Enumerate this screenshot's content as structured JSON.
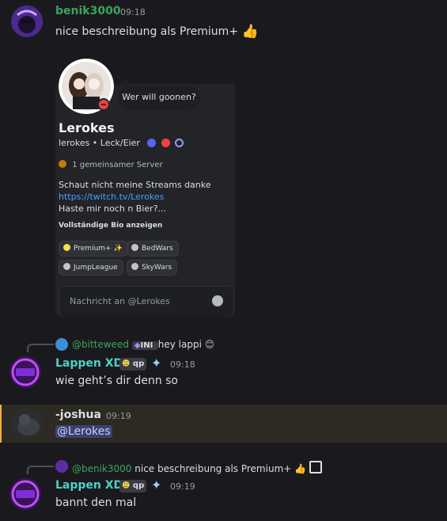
{
  "message1": {
    "username": "benik3000",
    "username_color": "#3ba55c",
    "time": "09:18",
    "text": "nice beschreibung als Premium+",
    "emoji": "👍"
  },
  "profile_card": {
    "status_bubble": "Wer will goonen?",
    "display_name": "Lerokes",
    "subline": "lerokes • Leck/Eier",
    "mutual_servers": "1 gemeinsamer Server",
    "bio_line1": "Schaut nicht meine Streams danke",
    "bio_link": "https://twitch.tv/Lerokes",
    "bio_line3": "Haste mir noch n Bier?...",
    "show_full_bio": "Vollständige Bio anzeigen",
    "roles": [
      {
        "label": "Premium+ ✨",
        "color": "#fde047"
      },
      {
        "label": "BedWars",
        "color": "#c4c4c4"
      },
      {
        "label": "JumpLeague",
        "color": "#c4c4c4"
      },
      {
        "label": "SkyWars",
        "color": "#c4c4c4"
      }
    ],
    "message_placeholder": "Nachricht an @Lerokes"
  },
  "message2": {
    "reply_user": "@bitteweed",
    "reply_user_color": "#3ba55c",
    "reply_tag": "INI",
    "reply_text": "hey lappi",
    "reply_emoji": "😊",
    "username": "Lappen XD",
    "username_color": "#4fd1c5",
    "badge": "qp",
    "time": "09:18",
    "text": "wie geht’s dir denn so"
  },
  "message3": {
    "username": "-joshua",
    "username_color": "#dbdee1",
    "time": "09:19",
    "mention": "@Lerokes"
  },
  "message4": {
    "reply_user": "@benik3000",
    "reply_user_color": "#3ba55c",
    "reply_text": "nice beschreibung als Premium+",
    "reply_emoji": "👍",
    "username": "Lappen XD",
    "username_color": "#4fd1c5",
    "badge": "qp",
    "time": "09:19",
    "text": "bannt den mal"
  }
}
